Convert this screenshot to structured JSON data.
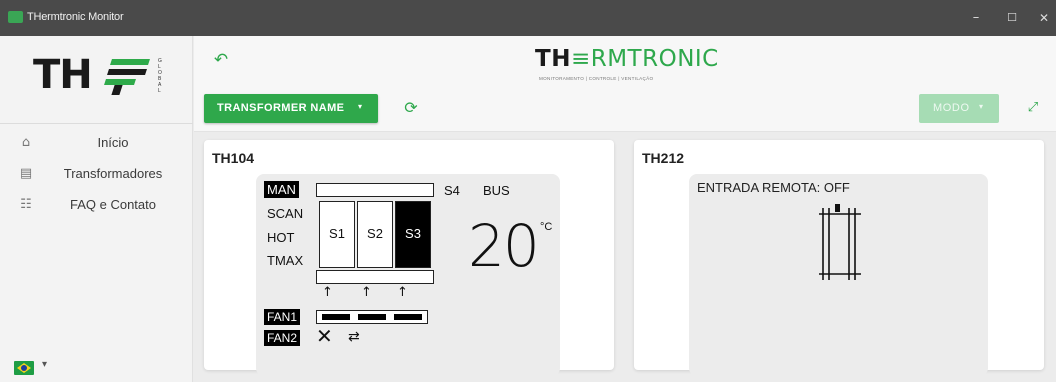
{
  "window": {
    "title": "THermtronic Monitor",
    "controls": {
      "minimize": "–",
      "maximize": "☐",
      "close": "✕"
    }
  },
  "sidebar": {
    "logo_text": "TH",
    "logo_tagline": "GLOBAL",
    "items": [
      {
        "label": "Início",
        "icon": "home-icon",
        "glyph": "⌂"
      },
      {
        "label": "Transformadores",
        "icon": "transformer-file-icon",
        "glyph": "▤"
      },
      {
        "label": "FAQ e Contato",
        "icon": "faq-icon",
        "glyph": "☷"
      }
    ],
    "language": {
      "flag": "brazil-flag-icon",
      "caret": "▾"
    }
  },
  "header": {
    "back_glyph": "↶",
    "brand_prefix": "TH",
    "brand_mid": "≡",
    "brand_suffix": "RMTRONIC",
    "brand_subtitle": "MONITORAMENTO  |  CONTROLE  |  VENTILAÇÃO",
    "transformer_button": "TRANSFORMER NAME",
    "transformer_caret": "▾",
    "refresh_glyph": "⟳",
    "mode_button": "MODO",
    "mode_caret": "▾",
    "expand_glyph": "⤢"
  },
  "cards": [
    {
      "title": "TH104",
      "modes": [
        "MAN",
        "SCAN",
        "HOT",
        "TMAX"
      ],
      "active_mode": "MAN",
      "stages": [
        "S1",
        "S2",
        "S3"
      ],
      "active_stage": "S3",
      "s4_label": "S4",
      "bus_label": "BUS",
      "temperature": "20",
      "unit": "°C",
      "fans": [
        "FAN1",
        "FAN2"
      ],
      "arrow_glyph": "↑",
      "fan2_off_glyph": "✕",
      "fan2_swap_glyph": "⇄"
    },
    {
      "title": "TH212",
      "remote_status": "ENTRADA REMOTA: OFF"
    }
  ],
  "colors": {
    "accent": "#2fa84b",
    "accent_disabled": "#a6dcb4",
    "titlebar": "#4a4a4a",
    "panel": "#ececec"
  }
}
